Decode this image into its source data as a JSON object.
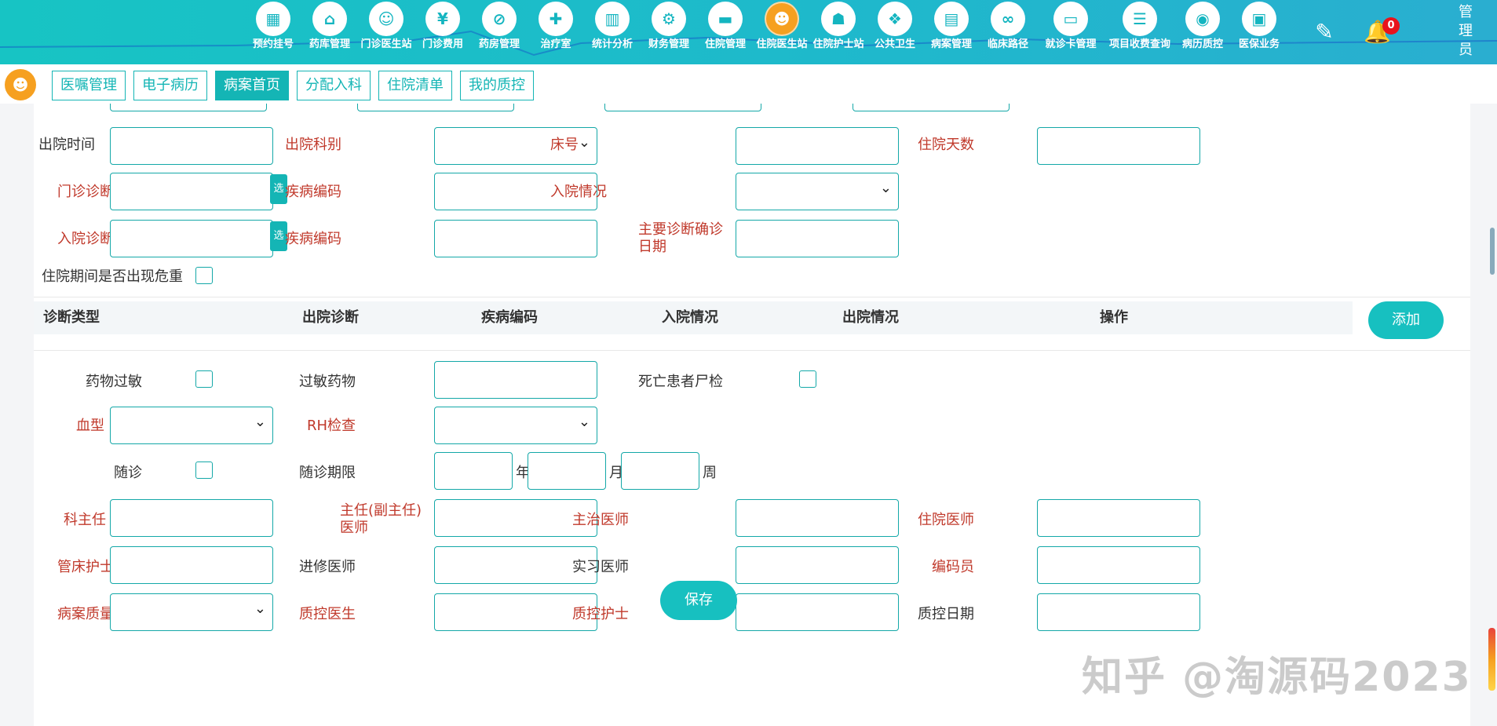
{
  "topnav": {
    "items": [
      {
        "label": "预约挂号",
        "icon": "calendar-icon",
        "glyph": "▦",
        "active": false,
        "wide": false
      },
      {
        "label": "药库管理",
        "icon": "warehouse-icon",
        "glyph": "⌂",
        "active": false,
        "wide": false
      },
      {
        "label": "门诊医生站",
        "icon": "doctor-icon",
        "glyph": "☺",
        "active": false,
        "wide": false
      },
      {
        "label": "门诊费用",
        "icon": "yen-icon",
        "glyph": "¥",
        "active": false,
        "wide": false
      },
      {
        "label": "药房管理",
        "icon": "pill-icon",
        "glyph": "⊘",
        "active": false,
        "wide": false
      },
      {
        "label": "治疗室",
        "icon": "nurse-icon",
        "glyph": "✚",
        "active": false,
        "wide": false
      },
      {
        "label": "统计分析",
        "icon": "bar-chart-icon",
        "glyph": "▥",
        "active": false,
        "wide": false
      },
      {
        "label": "财务管理",
        "icon": "finance-gear-icon",
        "glyph": "⚙",
        "active": false,
        "wide": false
      },
      {
        "label": "住院管理",
        "icon": "hospital-bed-icon",
        "glyph": "▬",
        "active": false,
        "wide": false
      },
      {
        "label": "住院医生站",
        "icon": "inpatient-doctor-icon",
        "glyph": "☻",
        "active": true,
        "wide": false
      },
      {
        "label": "住院护士站",
        "icon": "nurse-station-icon",
        "glyph": "☗",
        "active": false,
        "wide": false
      },
      {
        "label": "公共卫生",
        "icon": "public-health-icon",
        "glyph": "❖",
        "active": false,
        "wide": false
      },
      {
        "label": "病案管理",
        "icon": "record-icon",
        "glyph": "▤",
        "active": false,
        "wide": false
      },
      {
        "label": "临床路径",
        "icon": "pathway-icon",
        "glyph": "∞",
        "active": false,
        "wide": false
      },
      {
        "label": "就诊卡管理",
        "icon": "card-icon",
        "glyph": "▭",
        "active": false,
        "wide": true
      },
      {
        "label": "项目收费查询",
        "icon": "fee-query-icon",
        "glyph": "☰",
        "active": false,
        "wide": true
      },
      {
        "label": "病历质控",
        "icon": "quality-control-icon",
        "glyph": "◉",
        "active": false,
        "wide": false
      },
      {
        "label": "医保业务",
        "icon": "insurance-icon",
        "glyph": "▣",
        "active": false,
        "wide": false
      }
    ],
    "edit_glyph": "✎",
    "bell_glyph": "🔔",
    "notification_count": "0",
    "admin_label": "管理员"
  },
  "tabbar": {
    "avatar_glyph": "☻",
    "tabs": [
      {
        "label": "医嘱管理",
        "active": false
      },
      {
        "label": "电子病历",
        "active": false
      },
      {
        "label": "病案首页",
        "active": true
      },
      {
        "label": "分配入科",
        "active": false
      },
      {
        "label": "住院清单",
        "active": false
      },
      {
        "label": "我的质控",
        "active": false
      }
    ]
  },
  "form": {
    "discharge_time": "出院时间",
    "discharge_dept": "出院科别",
    "bed_no": "床号",
    "stay_days": "住院天数",
    "outpatient_diag": "门诊诊断",
    "disease_code": "疾病编码",
    "admission_status": "入院情况",
    "admission_diag": "入院诊断",
    "main_diag_date": "主要诊断确诊日期",
    "pick_label": "选",
    "critical_label": "住院期间是否出现危重"
  },
  "diag_table": {
    "headers": [
      "诊断类型",
      "出院诊断",
      "疾病编码",
      "入院情况",
      "出院情况",
      "操作"
    ],
    "add_label": "添加"
  },
  "form2": {
    "drug_allergy": "药物过敏",
    "allergy_drug": "过敏药物",
    "autopsy": "死亡患者尸检",
    "blood_type": "血型",
    "rh_check": "RH检查",
    "followup": "随诊",
    "followup_period": "随诊期限",
    "unit_year": "年",
    "unit_month": "月",
    "unit_week": "周",
    "dept_director": "科主任",
    "chief_physician": "主任(副主任)医师",
    "attending": "主治医师",
    "resident": "住院医师",
    "bed_nurse": "管床护士",
    "visiting_doctor": "进修医师",
    "intern": "实习医师",
    "coder": "编码员",
    "record_quality": "病案质量",
    "qc_doctor": "质控医生",
    "qc_nurse": "质控护士",
    "qc_date": "质控日期",
    "save_label": "保存"
  },
  "watermark": "知乎 @淘源码2023"
}
